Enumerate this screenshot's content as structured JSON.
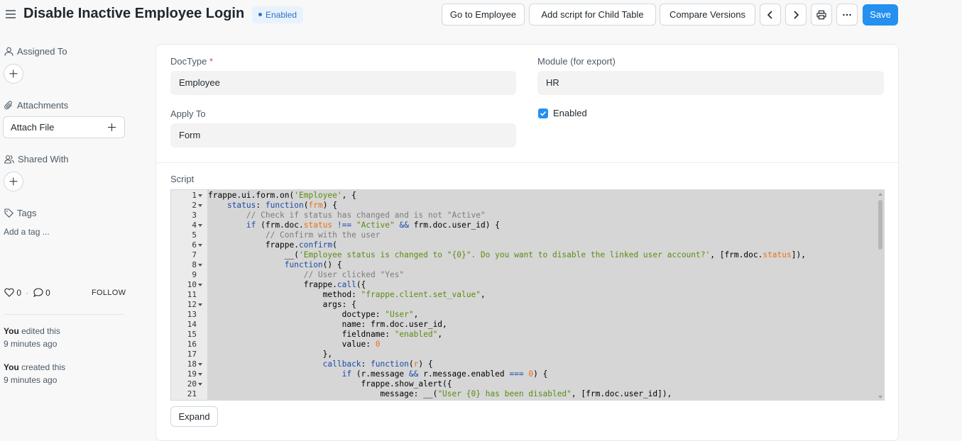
{
  "header": {
    "title": "Disable Inactive Employee Login",
    "status_badge": "Enabled",
    "buttons": {
      "go_to": "Go to Employee",
      "child_table": "Add script for Child Table",
      "compare": "Compare Versions",
      "save": "Save"
    },
    "icons": [
      "menu-icon",
      "chevron-left-icon",
      "chevron-right-icon",
      "printer-icon",
      "more-icon"
    ]
  },
  "sidebar": {
    "assigned_to": "Assigned To",
    "attachments": "Attachments",
    "attach_file": "Attach File",
    "shared_with": "Shared With",
    "tags": "Tags",
    "add_tag": "Add a tag ...",
    "likes": "0",
    "comments": "0",
    "follow": "FOLLOW",
    "activity": [
      {
        "who": "You",
        "action": " edited this",
        "when": "9 minutes ago"
      },
      {
        "who": "You",
        "action": " created this",
        "when": "9 minutes ago"
      }
    ]
  },
  "form": {
    "doctype_label": "DocType",
    "doctype_required": "*",
    "doctype_value": "Employee",
    "module_label": "Module (for export)",
    "module_value": "HR",
    "apply_to_label": "Apply To",
    "apply_to_value": "Form",
    "enabled_label": "Enabled",
    "enabled_checked": true,
    "script_label": "Script",
    "expand_label": "Expand"
  },
  "colors": {
    "primary": "#2490ef",
    "badge_bg": "#e8f2fc",
    "badge_text": "#2e72c2"
  },
  "code_lines": [
    {
      "n": "1",
      "fold": true,
      "html": "frappe.ui.form.on(<span class='s'>'Employee'</span>, {"
    },
    {
      "n": "2",
      "fold": true,
      "html": "    <span class='k'>status</span>: <span class='k'>function</span>(<span class='v'>frm</span>) {"
    },
    {
      "n": "3",
      "fold": false,
      "html": "        <span class='c'>// Check if status has changed and is not \"Active\"</span>"
    },
    {
      "n": "4",
      "fold": true,
      "html": "        <span class='k'>if</span> (frm.doc.<span class='v'>status</span> <span class='k'>!==</span> <span class='s'>\"Active\"</span> <span class='k'>&amp;&amp;</span> frm.doc.user_id) {"
    },
    {
      "n": "5",
      "fold": false,
      "html": "            <span class='c'>// Confirm with the user</span>"
    },
    {
      "n": "6",
      "fold": true,
      "html": "            frappe.<span class='k'>confirm</span>("
    },
    {
      "n": "7",
      "fold": false,
      "html": "                __(<span class='s'>'Employee status is changed to \"{0}\". Do you want to disable the linked user account?'</span>, [frm.doc.<span class='v'>status</span>]),"
    },
    {
      "n": "8",
      "fold": true,
      "html": "                <span class='k'>function</span>() {"
    },
    {
      "n": "9",
      "fold": false,
      "html": "                    <span class='c'>// User clicked \"Yes\"</span>"
    },
    {
      "n": "10",
      "fold": true,
      "html": "                    frappe.<span class='k'>call</span>({"
    },
    {
      "n": "11",
      "fold": false,
      "html": "                        method: <span class='s'>\"frappe.client.set_value\"</span>,"
    },
    {
      "n": "12",
      "fold": true,
      "html": "                        args: {"
    },
    {
      "n": "13",
      "fold": false,
      "html": "                            doctype: <span class='s'>\"User\"</span>,"
    },
    {
      "n": "14",
      "fold": false,
      "html": "                            name: frm.doc.user_id,"
    },
    {
      "n": "15",
      "fold": false,
      "html": "                            fieldname: <span class='s'>\"enabled\"</span>,"
    },
    {
      "n": "16",
      "fold": false,
      "html": "                            value: <span class='n'>0</span>"
    },
    {
      "n": "17",
      "fold": false,
      "html": "                        },"
    },
    {
      "n": "18",
      "fold": true,
      "html": "                        <span class='k'>callback</span>: <span class='k'>function</span>(<span class='v'>r</span>) {"
    },
    {
      "n": "19",
      "fold": true,
      "html": "                            <span class='k'>if</span> (r.message <span class='k'>&amp;&amp;</span> r.message.enabled <span class='k'>===</span> <span class='n'>0</span>) {"
    },
    {
      "n": "20",
      "fold": true,
      "html": "                                frappe.show_alert({"
    },
    {
      "n": "21",
      "fold": false,
      "html": "                                    message: __(<span class='s'>\"User {0} has been disabled\"</span>, [frm.doc.user_id]),"
    }
  ]
}
